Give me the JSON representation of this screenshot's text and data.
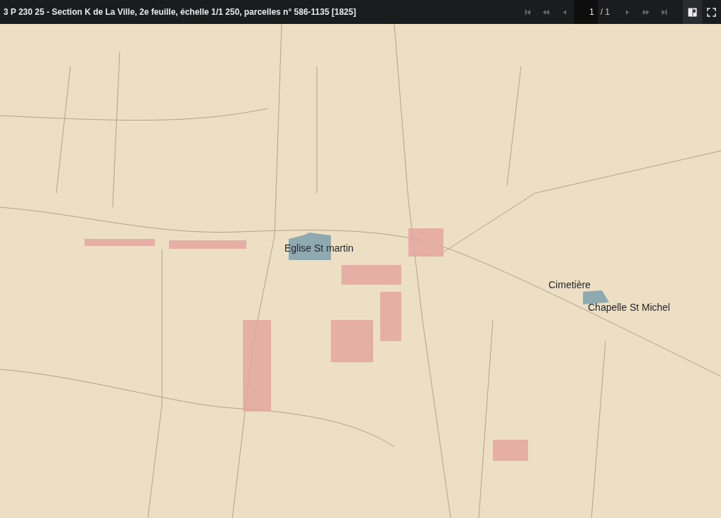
{
  "header": {
    "title": "3 P 230 25 - Section K de La Ville, 2e feuille, échelle 1/1 250, parcelles n° 586-1135 [1825]",
    "pager": {
      "buttons": [
        {
          "kind": "first",
          "disabled": true
        },
        {
          "kind": "fast_back",
          "disabled": true
        },
        {
          "kind": "prev",
          "disabled": true
        },
        {
          "kind": "page_field"
        },
        {
          "kind": "next",
          "disabled": true
        },
        {
          "kind": "fast_forward",
          "disabled": true
        },
        {
          "kind": "last",
          "disabled": true
        }
      ],
      "page": "1",
      "total": "/ 1"
    },
    "view_buttons": [
      {
        "kind": "panel",
        "selected": true
      },
      {
        "kind": "fullscreen",
        "selected": false
      }
    ]
  },
  "map": {
    "labels": [
      {
        "text": "Eglise St martin"
      },
      {
        "text": "Cimetière"
      },
      {
        "text": "Chapelle St Michel"
      }
    ]
  }
}
